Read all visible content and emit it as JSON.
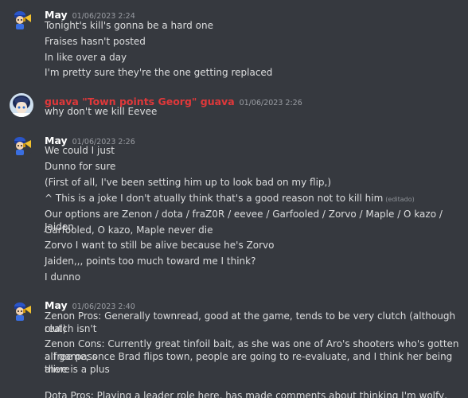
{
  "messages": [
    {
      "author": "May",
      "timestamp": "01/06/2023 2:24",
      "author_color": "#ffffff",
      "lines": [
        "Tonight's kill's gonna be a hard one",
        "Fraises hasn't posted",
        "In like over a day",
        "I'm pretty sure they're the one getting replaced"
      ]
    },
    {
      "author": "guava \"Town points Georg\" guava",
      "timestamp": "01/06/2023 2:26",
      "author_color": "#e0383a",
      "lines": [
        "why don't we kill Eevee"
      ]
    },
    {
      "author": "May",
      "timestamp": "01/06/2023 2:26",
      "author_color": "#ffffff",
      "lines": [
        "We could I just",
        "Dunno for sure",
        "(First of all, I've been setting him up to look bad on my flip,)",
        "^ This is a joke I don't atually think that's a good reason not to kill him",
        "Our options are Zenon / dota / fraZ0R / eevee / Garfooled / Zorvo / Maple / O kazo / Jaiden",
        "Garfooled, O kazo, Maple never die",
        "Zorvo I want to still be alive because he's Zorvo",
        "Jaiden,,, points too much toward me I think?",
        "I dunno"
      ],
      "edited_label": "(editado)"
    },
    {
      "author": "May",
      "timestamp": "01/06/2023 2:40",
      "author_color": "#ffffff",
      "lines": [
        "Zenon Pros: Generally townread, good at the game, tends to be very clutch (although clutch isn't",
        "real)",
        "Zenon Cons: Currently great tinfoil bait, as she was one of Aro's shooters who's gotten a free pass",
        "all game; once Brad flips town, people are going to re-evaluate, and I think her being alive is a plus",
        "there",
        "Dota Pros: Playing a leader role here, has made comments about thinking I'm wolfy, has been"
      ]
    }
  ]
}
